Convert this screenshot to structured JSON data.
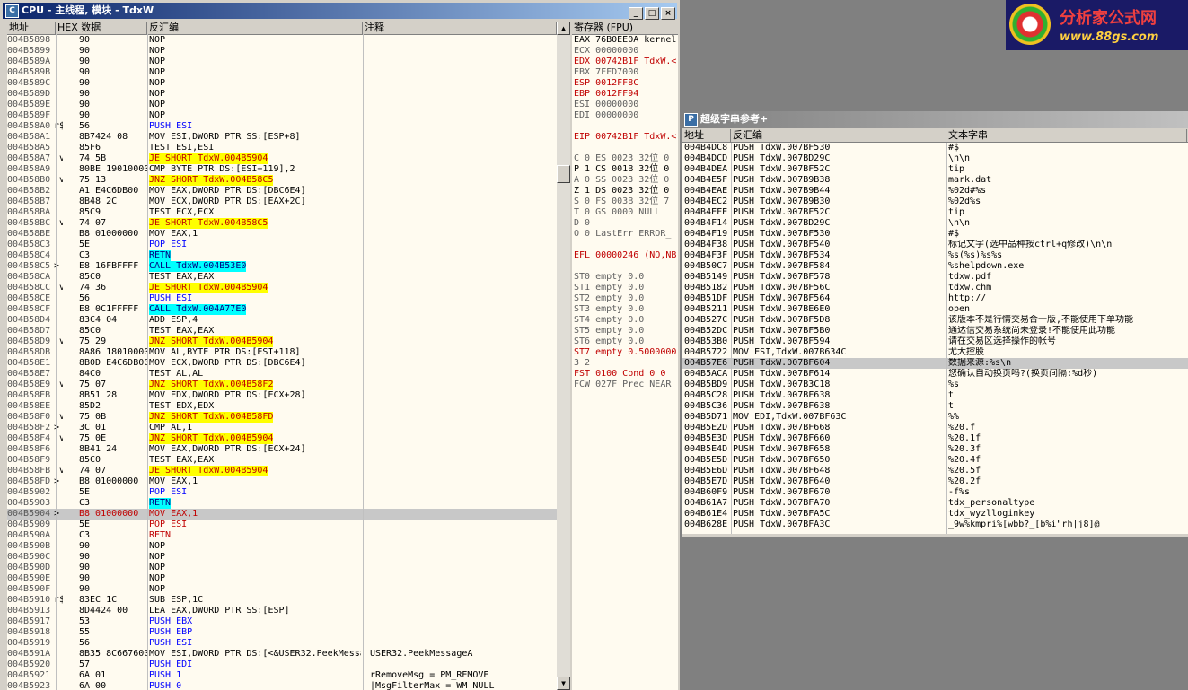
{
  "cpu_window": {
    "title": "CPU - 主线程, 模块 - TdxW",
    "buttons": {
      "min": "_",
      "max": "□",
      "close": "×"
    },
    "columns": {
      "address": "地址",
      "hex": "HEX 数据",
      "disasm": "反汇编",
      "comment": "注释"
    },
    "rows": [
      {
        "a": "004B5898",
        "m": "",
        "h": "90",
        "d": "NOP",
        "c": ""
      },
      {
        "a": "004B5899",
        "m": "",
        "h": "90",
        "d": "NOP",
        "c": ""
      },
      {
        "a": "004B589A",
        "m": "",
        "h": "90",
        "d": "NOP",
        "c": ""
      },
      {
        "a": "004B589B",
        "m": "",
        "h": "90",
        "d": "NOP",
        "c": ""
      },
      {
        "a": "004B589C",
        "m": "",
        "h": "90",
        "d": "NOP",
        "c": ""
      },
      {
        "a": "004B589D",
        "m": "",
        "h": "90",
        "d": "NOP",
        "c": ""
      },
      {
        "a": "004B589E",
        "m": "",
        "h": "90",
        "d": "NOP",
        "c": ""
      },
      {
        "a": "004B589F",
        "m": "",
        "h": "90",
        "d": "NOP",
        "c": ""
      },
      {
        "a": "004B58A0",
        "m": "r$",
        "h": "56",
        "d": "PUSH ESI",
        "c": "",
        "s": "blue"
      },
      {
        "a": "004B58A1",
        "m": ".",
        "h": "8B7424 08",
        "d": "MOV ESI,DWORD PTR SS:[ESP+8]",
        "c": "",
        "s": "cyanpart"
      },
      {
        "a": "004B58A5",
        "m": ".",
        "h": "85F6",
        "d": "TEST ESI,ESI",
        "c": ""
      },
      {
        "a": "004B58A7",
        "m": ".v",
        "h": "74 5B",
        "d": "JE SHORT TdxW.004B5904",
        "c": "",
        "s": "y"
      },
      {
        "a": "004B58A9",
        "m": ".",
        "h": "80BE 19010000",
        "d": "CMP BYTE PTR DS:[ESI+119],2",
        "c": ""
      },
      {
        "a": "004B58B0",
        "m": ".v",
        "h": "75 13",
        "d": "JNZ SHORT TdxW.004B58C5",
        "c": "",
        "s": "y"
      },
      {
        "a": "004B58B2",
        "m": ".",
        "h": "A1 E4C6DB00",
        "d": "MOV EAX,DWORD PTR DS:[DBC6E4]",
        "c": ""
      },
      {
        "a": "004B58B7",
        "m": ".",
        "h": "8B48 2C",
        "d": "MOV ECX,DWORD PTR DS:[EAX+2C]",
        "c": ""
      },
      {
        "a": "004B58BA",
        "m": ".",
        "h": "85C9",
        "d": "TEST ECX,ECX",
        "c": ""
      },
      {
        "a": "004B58BC",
        "m": ".v",
        "h": "74 07",
        "d": "JE SHORT TdxW.004B58C5",
        "c": "",
        "s": "y"
      },
      {
        "a": "004B58BE",
        "m": ".",
        "h": "B8 01000000",
        "d": "MOV EAX,1",
        "c": ""
      },
      {
        "a": "004B58C3",
        "m": ".",
        "h": "5E",
        "d": "POP ESI",
        "c": "",
        "s": "blue"
      },
      {
        "a": "004B58C4",
        "m": ".",
        "h": "C3",
        "d": "RETN",
        "c": "",
        "s": "cyan"
      },
      {
        "a": "004B58C5",
        "m": ">",
        "h": "E8 16FBFFFF",
        "d": "CALL TdxW.004B53E0",
        "c": "",
        "s": "cyan"
      },
      {
        "a": "004B58CA",
        "m": ".",
        "h": "85C0",
        "d": "TEST EAX,EAX",
        "c": ""
      },
      {
        "a": "004B58CC",
        "m": ".v",
        "h": "74 36",
        "d": "JE SHORT TdxW.004B5904",
        "c": "",
        "s": "y"
      },
      {
        "a": "004B58CE",
        "m": ".",
        "h": "56",
        "d": "PUSH ESI",
        "c": "",
        "s": "blue"
      },
      {
        "a": "004B58CF",
        "m": ".",
        "h": "E8 0C1FFFFF",
        "d": "CALL TdxW.004A77E0",
        "c": "",
        "s": "cyan"
      },
      {
        "a": "004B58D4",
        "m": ".",
        "h": "83C4 04",
        "d": "ADD ESP,4",
        "c": ""
      },
      {
        "a": "004B58D7",
        "m": ".",
        "h": "85C0",
        "d": "TEST EAX,EAX",
        "c": ""
      },
      {
        "a": "004B58D9",
        "m": ".v",
        "h": "75 29",
        "d": "JNZ SHORT TdxW.004B5904",
        "c": "",
        "s": "y"
      },
      {
        "a": "004B58DB",
        "m": ".",
        "h": "8A86 18010000",
        "d": "MOV AL,BYTE PTR DS:[ESI+118]",
        "c": ""
      },
      {
        "a": "004B58E1",
        "m": ".",
        "h": "8B0D E4C6DB00",
        "d": "MOV ECX,DWORD PTR DS:[DBC6E4]",
        "c": ""
      },
      {
        "a": "004B58E7",
        "m": ".",
        "h": "84C0",
        "d": "TEST AL,AL",
        "c": ""
      },
      {
        "a": "004B58E9",
        "m": ".v",
        "h": "75 07",
        "d": "JNZ SHORT TdxW.004B58F2",
        "c": "",
        "s": "y"
      },
      {
        "a": "004B58EB",
        "m": ".",
        "h": "8B51 28",
        "d": "MOV EDX,DWORD PTR DS:[ECX+28]",
        "c": ""
      },
      {
        "a": "004B58EE",
        "m": ".",
        "h": "85D2",
        "d": "TEST EDX,EDX",
        "c": ""
      },
      {
        "a": "004B58F0",
        "m": ".v",
        "h": "75 0B",
        "d": "JNZ SHORT TdxW.004B58FD",
        "c": "",
        "s": "y"
      },
      {
        "a": "004B58F2",
        "m": ">",
        "h": "3C 01",
        "d": "CMP AL,1",
        "c": ""
      },
      {
        "a": "004B58F4",
        "m": ".v",
        "h": "75 0E",
        "d": "JNZ SHORT TdxW.004B5904",
        "c": "",
        "s": "y"
      },
      {
        "a": "004B58F6",
        "m": ".",
        "h": "8B41 24",
        "d": "MOV EAX,DWORD PTR DS:[ECX+24]",
        "c": ""
      },
      {
        "a": "004B58F9",
        "m": ".",
        "h": "85C0",
        "d": "TEST EAX,EAX",
        "c": ""
      },
      {
        "a": "004B58FB",
        "m": ".v",
        "h": "74 07",
        "d": "JE SHORT TdxW.004B5904",
        "c": "",
        "s": "y"
      },
      {
        "a": "004B58FD",
        "m": ">",
        "h": "B8 01000000",
        "d": "MOV EAX,1",
        "c": ""
      },
      {
        "a": "004B5902",
        "m": ".",
        "h": "5E",
        "d": "POP ESI",
        "c": "",
        "s": "blue"
      },
      {
        "a": "004B5903",
        "m": ".",
        "h": "C3",
        "d": "RETN",
        "c": "",
        "s": "cyan"
      },
      {
        "a": "004B5904",
        "m": ">",
        "h": "B8 01000000",
        "d": "MOV EAX,1",
        "c": "",
        "s": "hl"
      },
      {
        "a": "004B5909",
        "m": ".",
        "h": "5E",
        "d": "POP ESI",
        "c": "",
        "s": "red"
      },
      {
        "a": "004B590A",
        "m": "",
        "h": "C3",
        "d": "RETN",
        "c": "",
        "s": "red"
      },
      {
        "a": "004B590B",
        "m": "",
        "h": "90",
        "d": "NOP",
        "c": ""
      },
      {
        "a": "004B590C",
        "m": "",
        "h": "90",
        "d": "NOP",
        "c": ""
      },
      {
        "a": "004B590D",
        "m": "",
        "h": "90",
        "d": "NOP",
        "c": ""
      },
      {
        "a": "004B590E",
        "m": "",
        "h": "90",
        "d": "NOP",
        "c": ""
      },
      {
        "a": "004B590F",
        "m": "",
        "h": "90",
        "d": "NOP",
        "c": ""
      },
      {
        "a": "004B5910",
        "m": "r$",
        "h": "83EC 1C",
        "d": "SUB ESP,1C",
        "c": ""
      },
      {
        "a": "004B5913",
        "m": ".",
        "h": "8D4424 00",
        "d": "LEA EAX,DWORD PTR SS:[ESP]",
        "c": "",
        "s": "cyanpart"
      },
      {
        "a": "004B5917",
        "m": ".",
        "h": "53",
        "d": "PUSH EBX",
        "c": "",
        "s": "blue"
      },
      {
        "a": "004B5918",
        "m": ".",
        "h": "55",
        "d": "PUSH EBP",
        "c": "",
        "s": "blue"
      },
      {
        "a": "004B5919",
        "m": ".",
        "h": "56",
        "d": "PUSH ESI",
        "c": "",
        "s": "blue"
      },
      {
        "a": "004B591A",
        "m": ".",
        "h": "8B35 8C667600",
        "d": "MOV ESI,DWORD PTR DS:[<&USER32.PeekMessa",
        "c": "USER32.PeekMessageA"
      },
      {
        "a": "004B5920",
        "m": ".",
        "h": "57",
        "d": "PUSH EDI",
        "c": "",
        "s": "blue"
      },
      {
        "a": "004B5921",
        "m": ".",
        "h": "6A 01",
        "d": "PUSH 1",
        "c": "rRemoveMsg = PM_REMOVE",
        "s": "blue"
      },
      {
        "a": "004B5923",
        "m": ".",
        "h": "6A 00",
        "d": "PUSH 0",
        "c": "|MsgFilterMax = WM_NULL",
        "s": "blue"
      }
    ]
  },
  "registers": {
    "title": "寄存器 (FPU)",
    "lines": [
      "EAX 76B0EE0A kernel",
      "ECX 00000000",
      "EDX 00742B1F TdxW.<",
      "EBX 7FFD7000",
      "ESP 0012FF8C",
      "EBP 0012FF94",
      "ESI 00000000",
      "EDI 00000000",
      "",
      "EIP 00742B1F TdxW.<",
      "",
      "C 0  ES 0023 32位 0",
      "P 1  CS 001B 32位 0",
      "A 0  SS 0023 32位 0",
      "Z 1  DS 0023 32位 0",
      "S 0  FS 003B 32位 7",
      "T 0  GS 0000 NULL",
      "D 0",
      "O 0  LastErr ERROR_",
      "",
      "EFL 00000246 (NO,NB",
      "",
      "ST0 empty 0.0",
      "ST1 empty 0.0",
      "ST2 empty 0.0",
      "ST3 empty 0.0",
      "ST4 empty 0.0",
      "ST5 empty 0.0",
      "ST6 empty 0.0",
      "ST7 empty 0.5000000",
      "               3 2",
      "FST 0100  Cond 0 0",
      "FCW 027F  Prec NEAR"
    ]
  },
  "logo": {
    "title": "分析家公式网",
    "url": "www.88gs.com"
  },
  "ref_window": {
    "title": "超级字串参考+",
    "columns": {
      "address": "地址",
      "disasm": "反汇编",
      "text": "文本字串"
    },
    "rows": [
      {
        "a": "004B4DC8",
        "d": "PUSH TdxW.007BF530",
        "t": "#$"
      },
      {
        "a": "004B4DCD",
        "d": "PUSH TdxW.007BD29C",
        "t": "\\n\\n"
      },
      {
        "a": "004B4DEA",
        "d": "PUSH TdxW.007BF52C",
        "t": "tip"
      },
      {
        "a": "004B4E5F",
        "d": "PUSH TdxW.007B9B38",
        "t": "mark.dat"
      },
      {
        "a": "004B4EAE",
        "d": "PUSH TdxW.007B9B44",
        "t": "%02d#%s"
      },
      {
        "a": "004B4EC2",
        "d": "PUSH TdxW.007B9B30",
        "t": "%02d%s"
      },
      {
        "a": "004B4EFE",
        "d": "PUSH TdxW.007BF52C",
        "t": "tip"
      },
      {
        "a": "004B4F14",
        "d": "PUSH TdxW.007BD29C",
        "t": "\\n\\n"
      },
      {
        "a": "004B4F19",
        "d": "PUSH TdxW.007BF530",
        "t": "#$"
      },
      {
        "a": "004B4F38",
        "d": "PUSH TdxW.007BF540",
        "t": "标记文字(选中品种按ctrl+q修改)\\n\\n"
      },
      {
        "a": "004B4F3F",
        "d": "PUSH TdxW.007BF534",
        "t": "%s(%s)%s%s"
      },
      {
        "a": "004B50C7",
        "d": "PUSH TdxW.007BF584",
        "t": "%shelpdown.exe"
      },
      {
        "a": "004B5149",
        "d": "PUSH TdxW.007BF578",
        "t": "tdxw.pdf"
      },
      {
        "a": "004B5182",
        "d": "PUSH TdxW.007BF56C",
        "t": "tdxw.chm"
      },
      {
        "a": "004B51DF",
        "d": "PUSH TdxW.007BF564",
        "t": "http://"
      },
      {
        "a": "004B5211",
        "d": "PUSH TdxW.007BE6E0",
        "t": "open"
      },
      {
        "a": "004B527C",
        "d": "PUSH TdxW.007BF5D8",
        "t": "该版本不是行情交易合一版,不能使用下单功能"
      },
      {
        "a": "004B52DC",
        "d": "PUSH TdxW.007BF5B0",
        "t": "通达信交易系统尚未登录!不能使用此功能"
      },
      {
        "a": "004B53B0",
        "d": "PUSH TdxW.007BF594",
        "t": "请在交易区选择操作的帐号"
      },
      {
        "a": "004B5722",
        "d": "MOV ESI,TdxW.007B634C",
        "t": "尤大控股"
      },
      {
        "a": "004B57E6",
        "d": "PUSH TdxW.007BF604",
        "t": "数据来源:%s\\n",
        "hl": true
      },
      {
        "a": "004B5ACA",
        "d": "PUSH TdxW.007BF614",
        "t": "您确认自动换页吗?(换页间隔:%d秒)"
      },
      {
        "a": "004B5BD9",
        "d": "PUSH TdxW.007B3C18",
        "t": "%s"
      },
      {
        "a": "004B5C28",
        "d": "PUSH TdxW.007BF638",
        "t": "t"
      },
      {
        "a": "004B5C36",
        "d": "PUSH TdxW.007BF638",
        "t": "t"
      },
      {
        "a": "004B5D71",
        "d": "MOV EDI,TdxW.007BF63C",
        "t": "%%"
      },
      {
        "a": "004B5E2D",
        "d": "PUSH TdxW.007BF668",
        "t": "%20.f"
      },
      {
        "a": "004B5E3D",
        "d": "PUSH TdxW.007BF660",
        "t": "%20.1f"
      },
      {
        "a": "004B5E4D",
        "d": "PUSH TdxW.007BF658",
        "t": "%20.3f"
      },
      {
        "a": "004B5E5D",
        "d": "PUSH TdxW.007BF650",
        "t": "%20.4f"
      },
      {
        "a": "004B5E6D",
        "d": "PUSH TdxW.007BF648",
        "t": "%20.5f"
      },
      {
        "a": "004B5E7D",
        "d": "PUSH TdxW.007BF640",
        "t": "%20.2f"
      },
      {
        "a": "004B60F9",
        "d": "PUSH TdxW.007BF670",
        "t": "-f%s"
      },
      {
        "a": "004B61A7",
        "d": "PUSH TdxW.007BFA70",
        "t": "tdx_personaltype"
      },
      {
        "a": "004B61E4",
        "d": "PUSH TdxW.007BFA5C",
        "t": "tdx_wyzlloginkey"
      },
      {
        "a": "004B628E",
        "d": "PUSH TdxW.007BFA3C",
        "t": "_9w%kmpri%[wbb?_[b%i\"rh|j8]@"
      }
    ]
  }
}
